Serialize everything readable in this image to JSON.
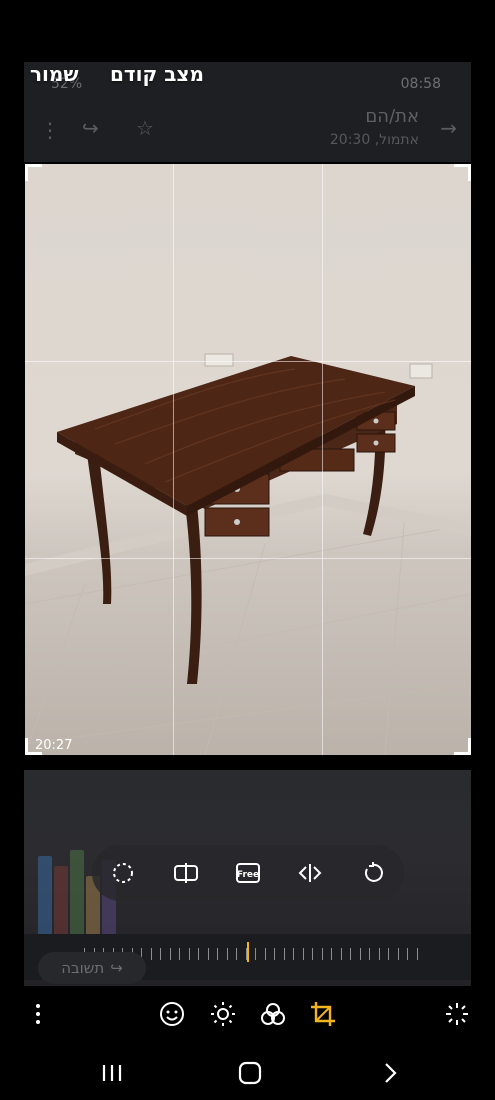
{
  "topbar": {
    "save_label": "שמור",
    "revert_label": "מצב קודם"
  },
  "background_chat": {
    "time": "08:58",
    "battery": "52%",
    "contact": "את/הם",
    "last_seen": "אתמול, 20:30",
    "reply_label": "תשובה"
  },
  "photo": {
    "timestamp": "20:27"
  },
  "colors": {
    "accent": "#f2b51d",
    "background": "#000000"
  },
  "tools": [
    "lasso-icon",
    "aspect-ratio-icon",
    "free-crop-icon",
    "flip-icon",
    "rotate-icon"
  ],
  "free_label": "Free",
  "rotation_value": 0,
  "bottom_tools": [
    "more-icon",
    "sticker-icon",
    "brightness-icon",
    "filters-icon",
    "crop-icon",
    "magic-icon"
  ],
  "navigation": [
    "recents-icon",
    "home-icon",
    "back-icon"
  ]
}
